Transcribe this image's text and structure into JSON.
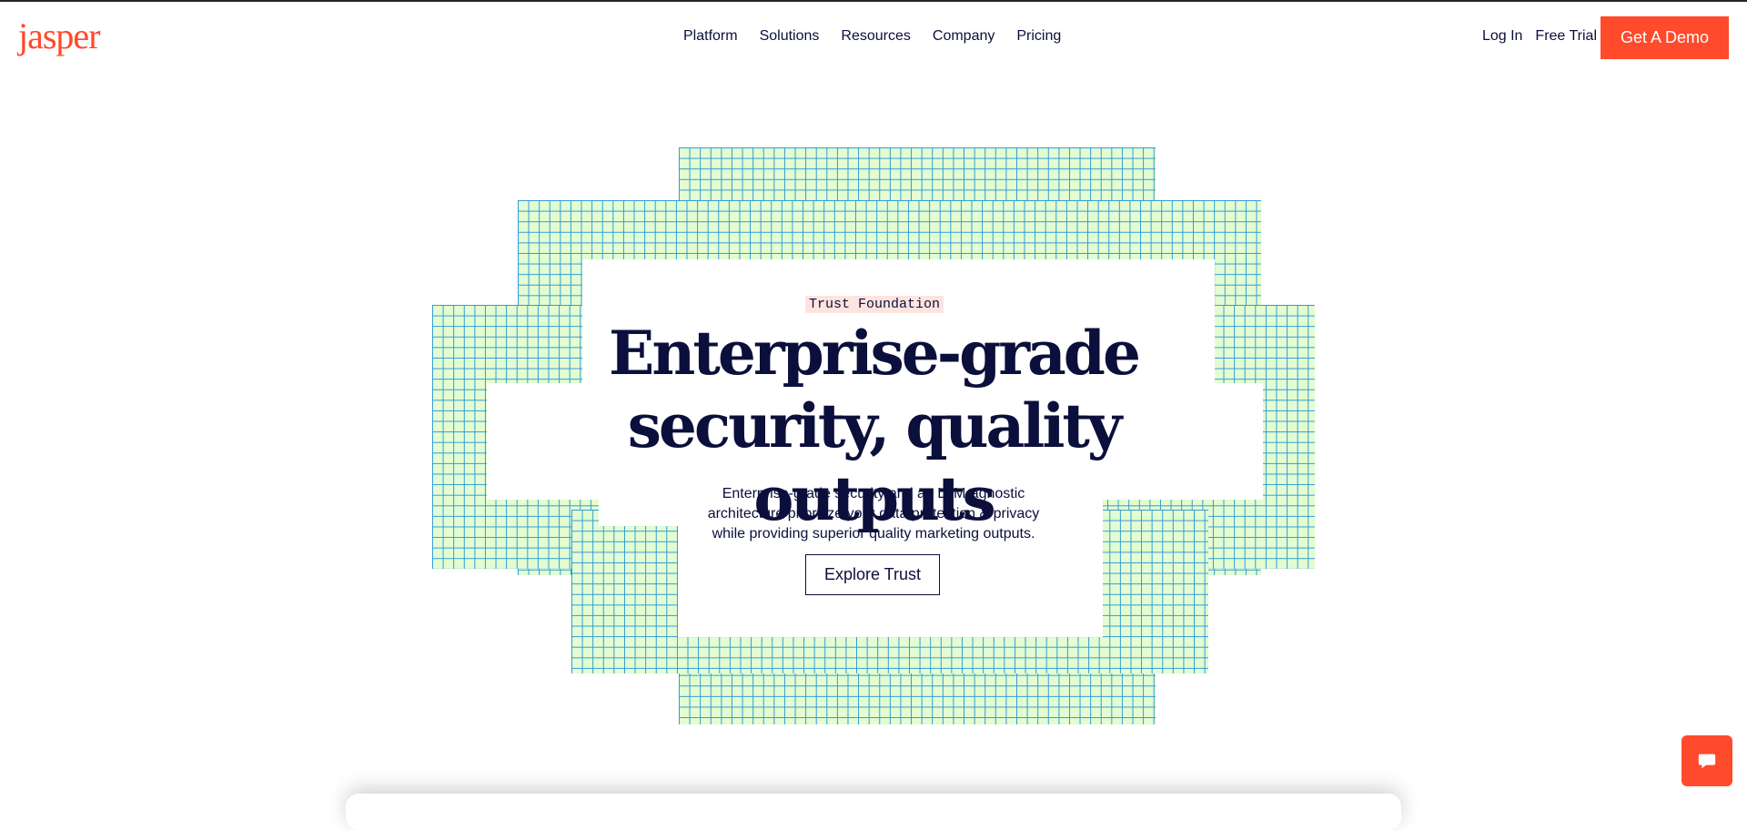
{
  "brand": {
    "logo_text": "jasper",
    "accent_color": "#ff4a2b",
    "grid_fill": "#e3fcd1",
    "grid_line": "#2f9bd6"
  },
  "nav": {
    "items": [
      "Platform",
      "Solutions",
      "Resources",
      "Company",
      "Pricing"
    ]
  },
  "header_actions": {
    "login": "Log In",
    "free_trial": "Free Trial",
    "demo": "Get A Demo"
  },
  "hero": {
    "eyebrow": "Trust Foundation",
    "headline_lines": [
      "Enterprise-grade",
      "security, quality outputs"
    ],
    "subtext_lines": [
      "Enterprise-grade security and an LLM-agnostic",
      "architecture prioritize your data protection & privacy",
      "while providing superior quality marketing outputs."
    ],
    "cta": "Explore Trust"
  },
  "chat": {
    "icon": "chat-bubble-icon"
  }
}
